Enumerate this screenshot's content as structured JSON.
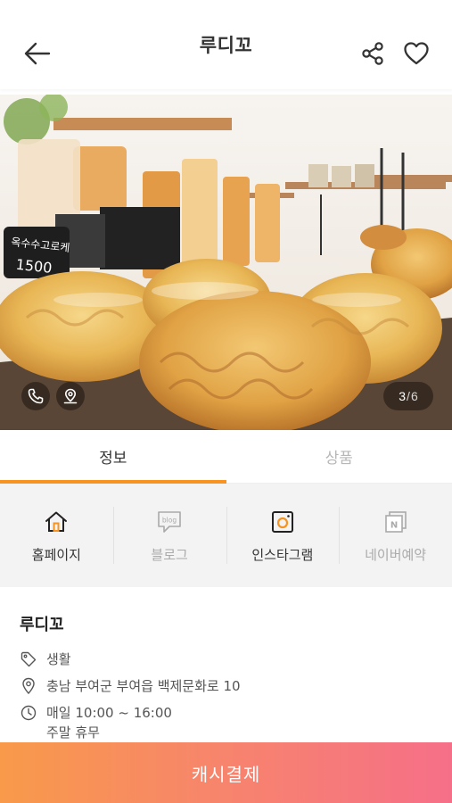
{
  "header": {
    "title": "루디꼬"
  },
  "hero": {
    "counter_current": "3",
    "counter_separator": "/",
    "counter_total": "6",
    "sign_text": "옥수수고로케 1500"
  },
  "tabs": [
    {
      "label": "정보",
      "active": true
    },
    {
      "label": "상품",
      "active": false
    }
  ],
  "links": [
    {
      "label": "홈페이지",
      "icon": "home-icon",
      "enabled": true
    },
    {
      "label": "블로그",
      "icon": "blog-icon",
      "enabled": false
    },
    {
      "label": "인스타그램",
      "icon": "instagram-icon",
      "enabled": true
    },
    {
      "label": "네이버예약",
      "icon": "naver-icon",
      "enabled": false
    }
  ],
  "info": {
    "name": "루디꼬",
    "category": "생활",
    "address": "충남 부여군 부여읍 백제문화로 10",
    "hours_line1": "매일 10:00 ~ 16:00",
    "hours_line2": "주말 휴무"
  },
  "cta": {
    "label": "캐시결제"
  },
  "colors": {
    "accent": "#f7931e",
    "cta_start": "#f89a4a",
    "cta_end": "#f66f88"
  }
}
